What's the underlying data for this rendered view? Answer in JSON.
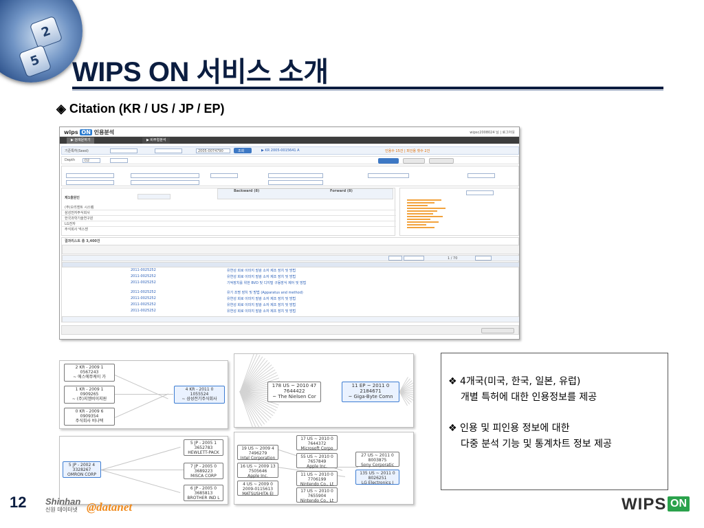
{
  "slide": {
    "title": "WIPS ON 서비스 소개",
    "subtitle": "◈ Citation (KR / US / JP / EP)",
    "page_number": "12"
  },
  "logo_keys": [
    "2",
    "5"
  ],
  "screenshot": {
    "brand_text": "wips",
    "brand_badge": "ON",
    "brand_label": "인용분석",
    "user_text": "wipsc2008024 님 | 로그아웃",
    "tabs": [
      "▶ 검색문하기",
      "▶ 비주얼분석"
    ],
    "search_label": "기준특허(Seed)",
    "search_value": "2005-0074790",
    "search_button": "조회",
    "seed_info": "▶ KR 2005-0015641 A",
    "depth_label": "Depth",
    "depth_value": "D2",
    "backward_label": "Backward (8)",
    "forward_label": "Forward (8)",
    "list_title": "제1출원인",
    "result_label": "결과리스트 총 3,400건",
    "company_rows": [
      "(주)오리엔트 시스템",
      "삼성전자주식회사",
      "한국과학기술연구원",
      "LG전자",
      "주식회사 넥스젠"
    ],
    "patent_numbers": [
      "2011-0025252",
      "2011-0025252",
      "2011-0025252",
      "2011-0025252",
      "2011-0025252",
      "2011-0025252",
      "2011-0025252"
    ],
    "patent_titles": [
      "유연성 회로 이미지 발광 소자 제조 장치 및 방법",
      "유연성 회로 이미지 발광 소자 제조 장치 및 방법",
      "기억장치를 위한 BVD 및 디지털 구동방식 제어 및 방법",
      "유기 조명 장치 및 방법 (Apparatus and method)",
      "유연성 회로 이미지 발광 소자 제조 장치 및 방법",
      "유연성 회로 이미지 발광 소자 제조 장치 및 방법",
      "유연성 회로 이미지 발광 소자 제조 장치 및 방법"
    ],
    "pagination": "1 / 70"
  },
  "network_panel_1": {
    "nodes": [
      {
        "ends": [
          "2",
          "KR - 2009",
          "1"
        ],
        "number": "0567243",
        "owner": "~ 에스에쭈케이 가"
      },
      {
        "ends": [
          "1",
          "KR - 2009",
          "1"
        ],
        "number": "0909265",
        "owner": "~ (주)지엠비이지원"
      },
      {
        "ends": [
          "0",
          "KR - 2009",
          "6"
        ],
        "number": "0909354",
        "owner": "주식회사 비나텍"
      },
      {
        "ends": [
          "4",
          "KR - 2011",
          "0"
        ],
        "number": "1055524",
        "owner": "~ 삼성전기주식회사"
      }
    ]
  },
  "network_panel_2": {
    "nodes": [
      {
        "ends": [
          "178",
          "US ~ 2010",
          "47"
        ],
        "number": "7644422",
        "owner": "~ The Nielsen Cor"
      },
      {
        "ends": [
          "11",
          "EP ~ 2011",
          "0"
        ],
        "number": "2184671",
        "owner": "~ Giga-Byte Comn"
      }
    ]
  },
  "network_panel_3": {
    "nodes": [
      {
        "ends": [
          "5",
          "JP - 2002",
          "4"
        ],
        "number": "3328267",
        "owner": "OMRON CORP"
      },
      {
        "ends": [
          "5",
          "JP - 2005",
          "1"
        ],
        "number": "3652783",
        "owner": "HEWLETT-PACK"
      },
      {
        "ends": [
          "7",
          "JP - 2005",
          "0"
        ],
        "number": "3689223",
        "owner": "MISCA CORP"
      },
      {
        "ends": [
          "6",
          "JP - 2005",
          "0"
        ],
        "number": "3685813",
        "owner": "BROTHER IND L"
      }
    ]
  },
  "network_panel_4": {
    "nodes": [
      {
        "ends": [
          "17",
          "US ~ 2010",
          "0"
        ],
        "number": "7644372",
        "owner": "Microsoft Corpo"
      },
      {
        "ends": [
          "19",
          "US ~ 2009",
          "4"
        ],
        "number": "7496279",
        "owner": "Intel Corporation"
      },
      {
        "ends": [
          "55",
          "US ~ 2010",
          "0"
        ],
        "number": "7657849",
        "owner": "Apple Inc."
      },
      {
        "ends": [
          "16",
          "US ~ 2009",
          "13"
        ],
        "number": "7505646",
        "owner": "Apple Inc."
      },
      {
        "ends": [
          "11",
          "US ~ 2010",
          "0"
        ],
        "number": "7706199",
        "owner": "Nintendo Co., Lt"
      },
      {
        "ends": [
          "4",
          "US ~ 2009",
          "0"
        ],
        "number": "2009-0115613",
        "owner": "MATSUSHITA EI"
      },
      {
        "ends": [
          "17",
          "US ~ 2010",
          "0"
        ],
        "number": "7655904",
        "owner": "Nintendo Co., Lt"
      },
      {
        "ends": [
          "27",
          "US ~ 2011",
          "0"
        ],
        "number": "8003875",
        "owner": "Sony Corporatic"
      },
      {
        "ends": [
          "135",
          "US ~ 2011",
          "0"
        ],
        "number": "8026251",
        "owner": "LG Electronics I"
      }
    ]
  },
  "info": {
    "bullet1_line1": "❖ 4개국(미국, 한국, 일본, 유럽)",
    "bullet1_line2": "개별 특허에 대한 인용정보를 제공",
    "bullet2_line1": "❖ 인용 및 피인용 정보에 대한",
    "bullet2_line2": "다중 분석 기능 및  통계차트 정보 제공"
  },
  "footer": {
    "shinhan_brand": "Shinhan",
    "shinhan_label": "신원 데이터넷",
    "datanet": "@datanet",
    "wips_text": "WIPS",
    "wips_badge": "ON"
  },
  "colors": {
    "title": "#0b1d40",
    "accent_blue": "#3d78c4",
    "chart_orange": "#f2a23c",
    "wips_green": "#2ba24c"
  }
}
